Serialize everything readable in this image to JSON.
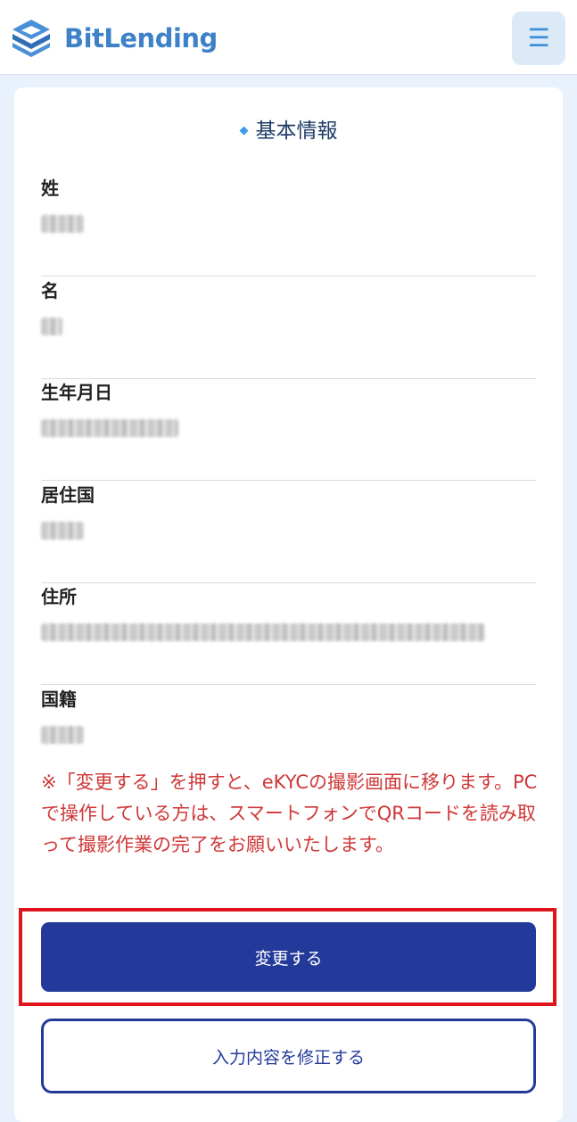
{
  "header": {
    "brand": "BitLending",
    "logo_icon": "bitlending-logo-icon",
    "menu_icon": "hamburger-menu-icon",
    "menu_glyph": "☰",
    "colors": {
      "brand": "#3d82c8",
      "menu_bg": "#dceaf8"
    }
  },
  "section": {
    "title": "基本情報",
    "title_icon": "diamond-icon"
  },
  "fields": [
    {
      "label": "姓",
      "value_state": "redacted"
    },
    {
      "label": "名",
      "value_state": "redacted"
    },
    {
      "label": "生年月日",
      "value_state": "redacted"
    },
    {
      "label": "居住国",
      "value_state": "redacted"
    },
    {
      "label": "住所",
      "value_state": "redacted"
    },
    {
      "label": "国籍",
      "value_state": "redacted"
    }
  ],
  "notice": "※「変更する」を押すと、eKYCの撮影画面に移ります。PCで操作している方は、スマートフォンでQRコードを読み取って撮影作業の完了をお願いいたします。",
  "buttons": {
    "change_label": "変更する",
    "edit_label": "入力内容を修正する"
  },
  "colors": {
    "primary": "#233a9a",
    "notice": "#cf3737",
    "highlight": "#e0141b",
    "page_bg": "#e8f1fc"
  }
}
